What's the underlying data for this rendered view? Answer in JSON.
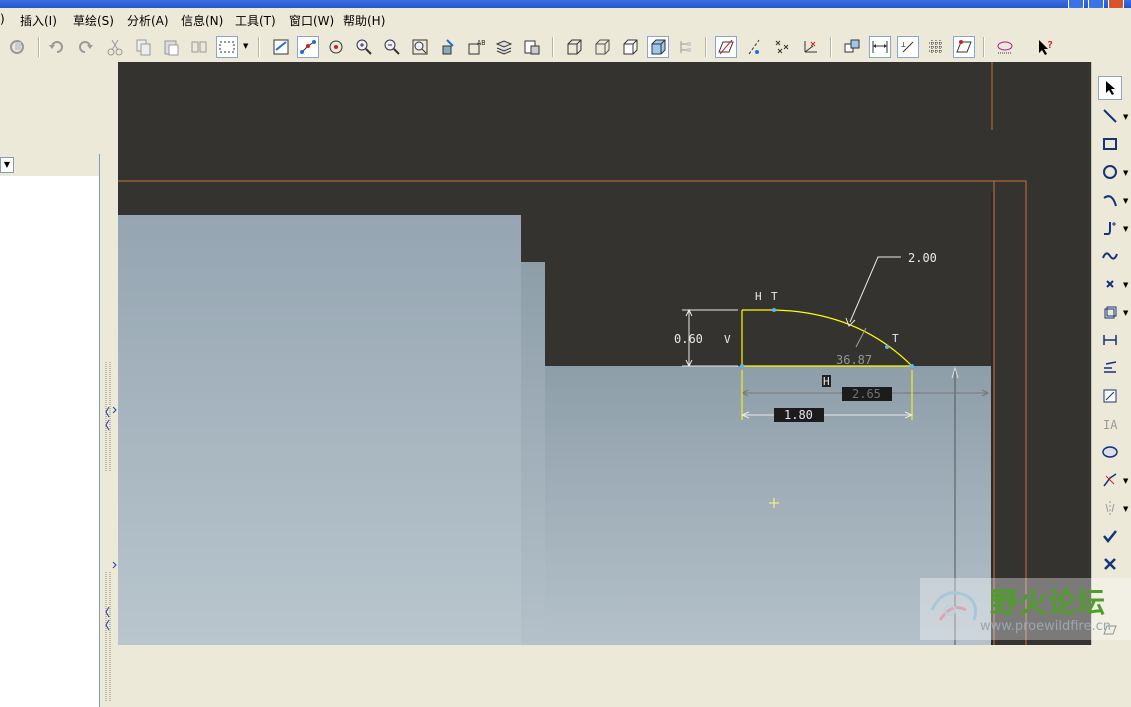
{
  "menu": {
    "items": [
      "插入(I)",
      "草绘(S)",
      "分析(A)",
      "信息(N)",
      "工具(T)",
      "窗口(W)",
      "帮助(H)"
    ]
  },
  "toolbar": {
    "icons": [
      "regenerate-icon",
      "undo-icon",
      "redo-icon",
      "cut-icon",
      "copy-icon",
      "paste-icon",
      "paste-special-icon",
      "select-box-icon",
      "sketch-view-icon",
      "datum-display-icon",
      "orient-icon",
      "zoom-in-icon",
      "zoom-out-icon",
      "refit-icon",
      "repaint-icon",
      "named-view-icon",
      "layers-icon",
      "view-manager-icon",
      "wireframe-icon",
      "hidden-line-icon",
      "no-hidden-icon",
      "shading-icon",
      "model-tree-icon",
      "datum-planes-icon",
      "datum-axes-icon",
      "datum-points-icon",
      "coordinate-sys-icon",
      "sketch-orient-icon",
      "dimension-display-icon",
      "constraint-display-icon",
      "grid-display-icon",
      "vertex-display-icon",
      "sketcher-diagnostics-icon",
      "context-help-icon"
    ]
  },
  "sketch": {
    "dim_arc": "2.00",
    "dim_height": "0.60",
    "dim_length": "1.80",
    "dim_width": "2.65",
    "dim_angle": "36.87",
    "label_H": "H",
    "label_T": "T",
    "label_V": "V"
  },
  "rightbar": {
    "icons": [
      "select-arrow-icon",
      "line-icon",
      "rectangle-icon",
      "circle-icon",
      "arc-icon",
      "fillet-icon",
      "spline-icon",
      "point-icon",
      "offset-icon",
      "dimension-icon",
      "modify-icon",
      "constraint-icon",
      "text-icon",
      "palette-icon",
      "trim-icon",
      "mirror-icon",
      "accept-icon",
      "cancel-icon"
    ]
  },
  "watermark": {
    "cn_text": "野火论坛",
    "url": "www.proewildfire.cn"
  },
  "colors": {
    "background": "#353330",
    "model_shade": "#a8b6c0",
    "sketch_yellow": "#ffff00",
    "dim_white": "#e8e8e8",
    "datum_orange": "#c8703a"
  }
}
